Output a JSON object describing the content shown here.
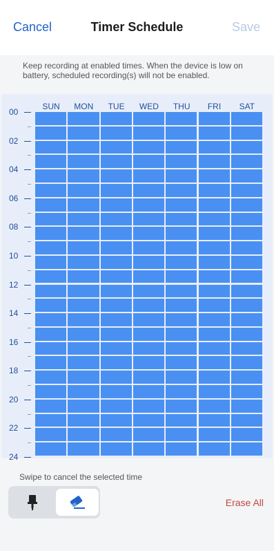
{
  "header": {
    "cancel_label": "Cancel",
    "title": "Timer Schedule",
    "save_label": "Save"
  },
  "notice": "Keep recording at enabled times. When the device is low on battery, scheduled recording(s) will not be enabled.",
  "schedule": {
    "days": [
      "SUN",
      "MON",
      "TUE",
      "WED",
      "THU",
      "FRI",
      "SAT"
    ],
    "hour_labels": [
      "00",
      "02",
      "04",
      "06",
      "08",
      "10",
      "12",
      "14",
      "16",
      "18",
      "20",
      "22",
      "24"
    ],
    "slots_per_day": 24,
    "enabled_fraction": 1.0,
    "colors": {
      "enabled": "#4a90f2",
      "axis": "#1f4e9d"
    }
  },
  "hint": "Swipe to cancel the selected time",
  "tools": {
    "brush_icon": "paint-brush-icon",
    "eraser_icon": "eraser-icon",
    "selected": "eraser"
  },
  "erase_all_label": "Erase All"
}
